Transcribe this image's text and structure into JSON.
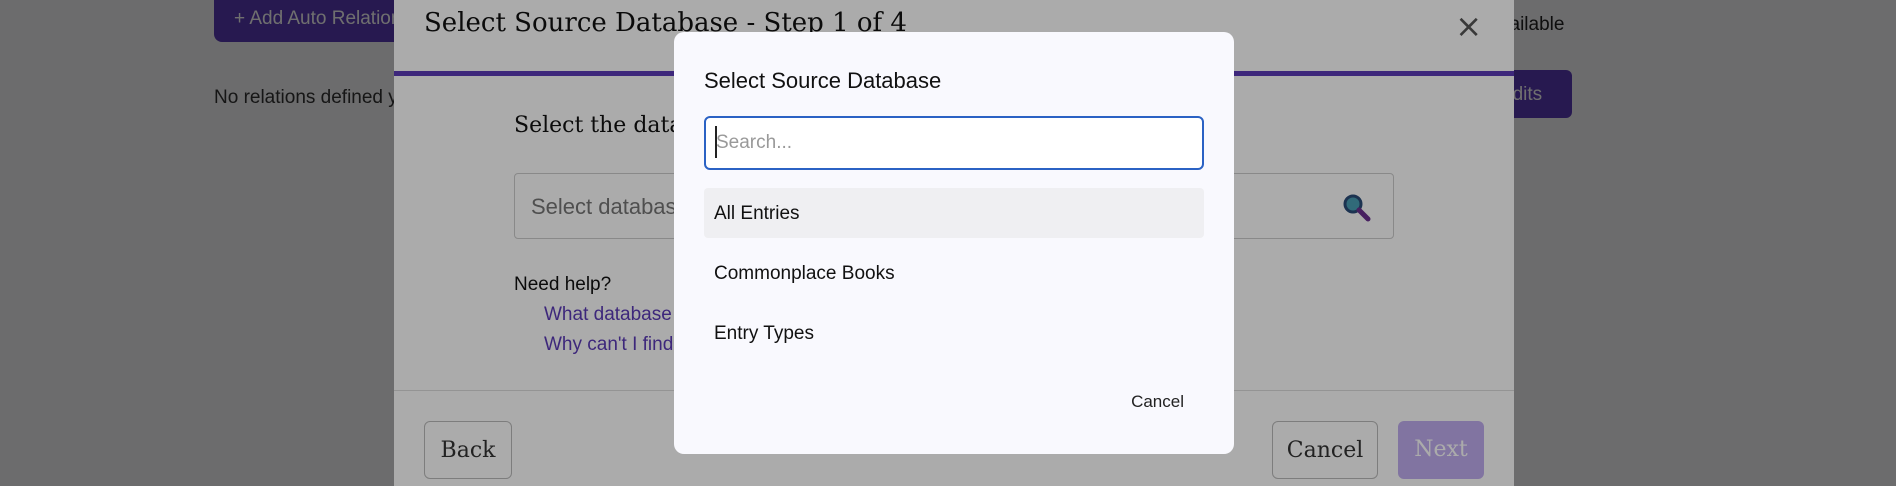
{
  "background": {
    "add_auto_button": "+ Add Auto Relation",
    "no_relations_text": "No relations defined y",
    "available_text": "vailable",
    "edits_button": "edits"
  },
  "wizard": {
    "title": "Select Source Database - Step 1 of 4",
    "close_icon": "×",
    "prompt": "Select the datab",
    "select_placeholder": "Select databas",
    "help_title": "Need help?",
    "help_links": [
      "What database",
      "Why can't I find"
    ],
    "back_label": "Back",
    "cancel_label": "Cancel",
    "next_label": "Next"
  },
  "picker": {
    "title": "Select Source Database",
    "search_placeholder": "Search...",
    "options": [
      "All Entries",
      "Commonplace Books",
      "Entry Types"
    ],
    "cancel_label": "Cancel"
  },
  "colors": {
    "accent": "#5b3bb8",
    "focus_border": "#2b62c4",
    "next_disabled": "#c1aef0"
  }
}
